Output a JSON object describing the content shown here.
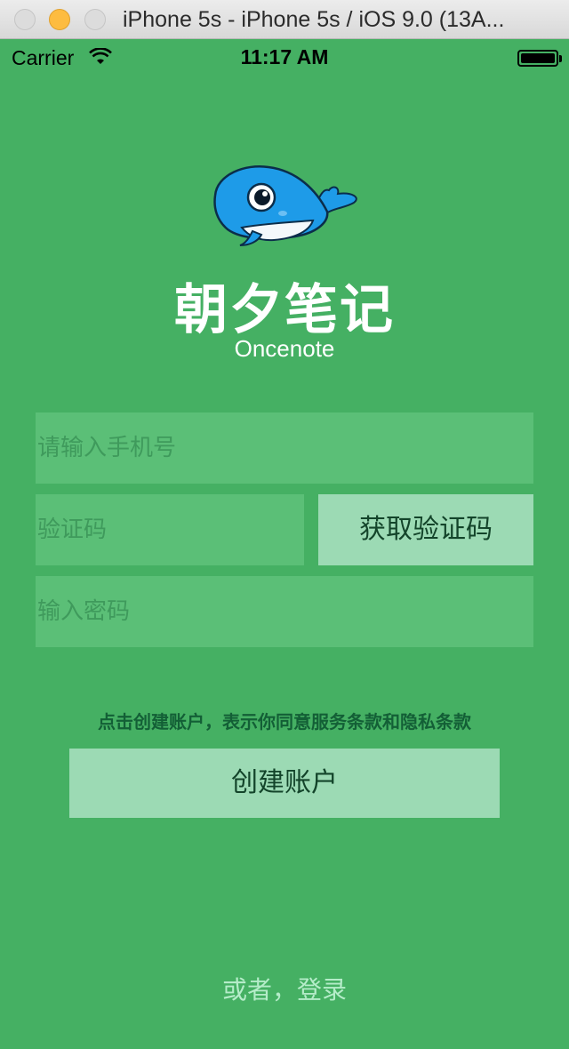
{
  "window": {
    "title": "iPhone 5s - iPhone 5s / iOS 9.0 (13A..."
  },
  "status_bar": {
    "carrier": "Carrier",
    "time": "11:17 AM",
    "icons": [
      "wifi-icon",
      "battery-icon"
    ]
  },
  "app": {
    "name": "朝夕笔记",
    "subtitle": "Oncenote",
    "logo": "whale-logo"
  },
  "form": {
    "phone_placeholder": "请输入手机号",
    "code_placeholder": "验证码",
    "get_code_label": "获取验证码",
    "password_placeholder": "输入密码",
    "terms_text": "点击创建账户，表示你同意服务条款和隐私条款",
    "create_label": "创建账户",
    "login_link": "或者，登录"
  },
  "colors": {
    "background": "#45b063",
    "field": "#5bbf77",
    "button": "#9cdab4",
    "button_text": "#13442a",
    "whale": "#1e9be8"
  }
}
